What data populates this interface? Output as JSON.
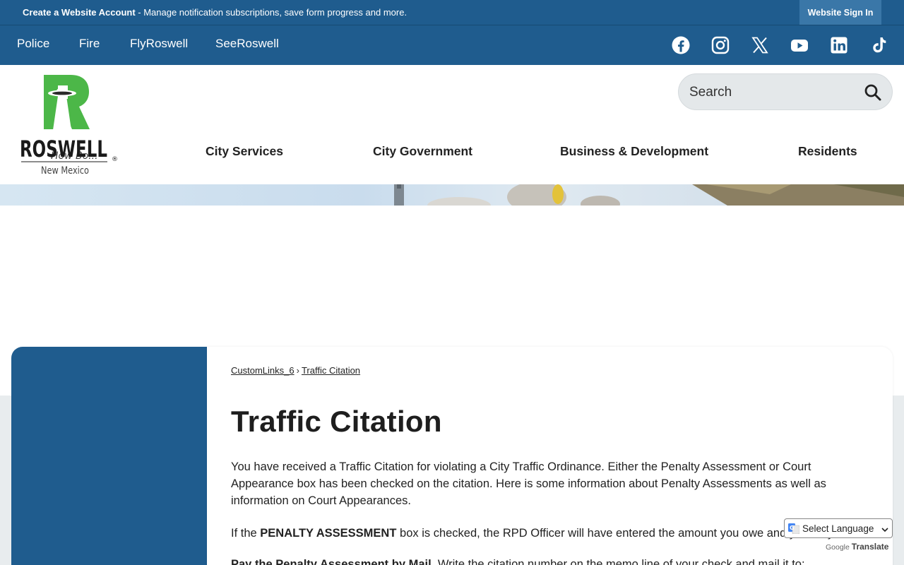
{
  "topbar": {
    "account_link": "Create a Website Account",
    "account_desc": " - Manage notification subscriptions, save form progress and more.",
    "signin_label": "Website Sign In"
  },
  "quicklinks": [
    "Police",
    "Fire",
    "FlyRoswell",
    "SeeRoswell"
  ],
  "social_icons": [
    "facebook-icon",
    "instagram-icon",
    "x-twitter-icon",
    "youtube-icon",
    "linkedin-icon",
    "tiktok-icon"
  ],
  "logo": {
    "name": "ROSWELL",
    "state": "New Mexico",
    "tagline": "How Bo...",
    "registered": "®"
  },
  "search": {
    "placeholder": "Search"
  },
  "main_nav": [
    "City Services",
    "City Government",
    "Business & Development",
    "Residents"
  ],
  "breadcrumb": {
    "parent": "CustomLinks_6",
    "separator": "›",
    "current": "Traffic Citation"
  },
  "page": {
    "title": "Traffic Citation",
    "intro": "You have received a Traffic Citation for violating a City Traffic Ordinance. Either the Penalty Assessment or Court Appearance box has been checked on the citation. Here is some information about Penalty Assessments as well as information on Court Appearances.",
    "p2_prefix": "If the ",
    "p2_bold": "PENALTY ASSESSMENT",
    "p2_rest": " box is checked, the RPD Officer will have entered the amount you owe and you may",
    "p3_bold": "Pay the Penalty Assessment by Mail",
    "p3_rest": ". Write the citation number on the memo line of your check and mail it to:"
  },
  "translate": {
    "select_label": "Select Language",
    "powered_by": "Google",
    "translate_label": "Translate"
  },
  "colors": {
    "brand_blue": "#1f5c8e",
    "logo_green": "#4cb748",
    "light_grey": "#e8ecee"
  }
}
